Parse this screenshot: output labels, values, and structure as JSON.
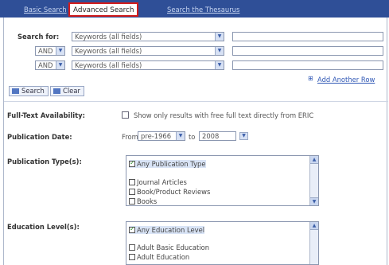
{
  "tabs": {
    "basic": "Basic Search",
    "advanced": "Advanced Search",
    "thesaurus": "Search the Thesaurus"
  },
  "search": {
    "label": "Search for:",
    "rows": [
      {
        "op": "",
        "field": "Keywords (all fields)",
        "value": ""
      },
      {
        "op": "AND",
        "field": "Keywords (all fields)",
        "value": ""
      },
      {
        "op": "AND",
        "field": "Keywords (all fields)",
        "value": ""
      }
    ],
    "add_row": "Add Another Row",
    "search_button": "Search",
    "clear_button": "Clear"
  },
  "fulltext": {
    "label": "Full-Text Availability:",
    "option": "Show only results with free full text directly from ERIC"
  },
  "pubdate": {
    "label": "Publication Date:",
    "from": "From",
    "from_value": "pre-1966",
    "to": "to",
    "to_value": "2008"
  },
  "pubtype": {
    "label": "Publication Type(s):",
    "items": [
      "Any Publication Type",
      "Journal Articles",
      "Book/Product Reviews",
      "Books"
    ]
  },
  "edlevel": {
    "label": "Education Level(s):",
    "items": [
      "Any Education Level",
      "Adult Basic Education",
      "Adult Education"
    ]
  },
  "icons": {
    "dropdown": "chevron-down-icon",
    "search": "search-icon",
    "clear": "clear-icon",
    "plus": "plus-icon"
  },
  "colors": {
    "tab_bar": "#2f4f97",
    "active_tab_border": "#d21c1c",
    "link": "#2f57b5"
  }
}
